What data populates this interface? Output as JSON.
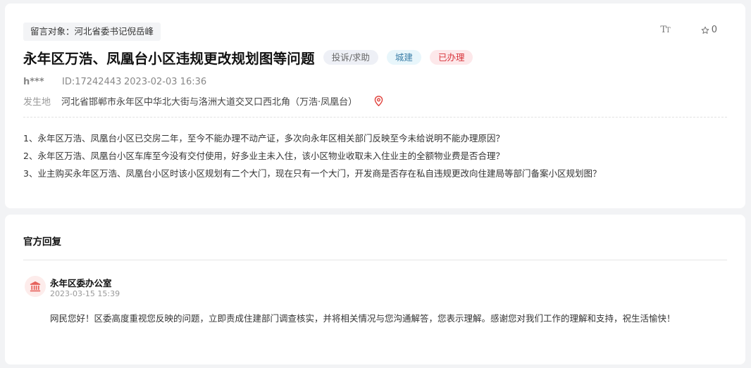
{
  "message": {
    "target_label": "留言对象：河北省委书记倪岳峰",
    "font_size_icon": "text-size-icon",
    "font_size_glyph_large": "T",
    "font_size_glyph_small": "T",
    "star_icon": "star-icon",
    "favorite_count": "0",
    "title": "永年区万浩、凤凰台小区违规更改规划图等问题",
    "tags": {
      "category": "投诉/求助",
      "department": "城建",
      "status": "已办理"
    },
    "author": "h***",
    "id_text": "ID:17242443",
    "datetime": "2023-02-03 16:36",
    "location_label": "发生地",
    "location_text": "河北省邯郸市永年区中华北大街与洛洲大道交叉口西北角（万浩·凤凰台）",
    "location_icon": "map-pin-icon",
    "content_lines": [
      "1、永年区万浩、凤凰台小区已交房二年，至今不能办理不动产证，多次向永年区相关部门反映至今未给说明不能办理原因？",
      "2、永年区万浩、凤凰台小区车库至今没有交付使用，好多业主未入住，该小区物业收取未入住业主的全额物业费是否合理？",
      "3、业主购买永年区万浩、凤凰台小区时该小区规划有二个大门，现在只有一个大门，开发商是否存在私自违规更改向住建局等部门备案小区规划图？"
    ]
  },
  "reply": {
    "heading": "官方回复",
    "org_icon": "government-building-icon",
    "org_name": "永年区委办公室",
    "datetime": "2023-03-15 15:39",
    "text": "网民您好！区委高度重视您反映的问题，立即责成住建部门调查核实，并将相关情况与您沟通解答，您表示理解。感谢您对我们工作的理解和支持，祝生活愉快！"
  },
  "colors": {
    "page_bg": "#f2f3f5",
    "status_red": "#d8343b",
    "department_blue": "#3b7fa8",
    "pin_red": "#e0403a"
  }
}
